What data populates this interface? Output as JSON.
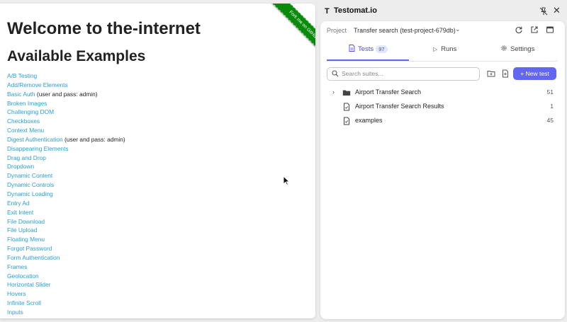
{
  "page": {
    "heading": "Welcome to the-internet",
    "subheading": "Available Examples",
    "ribbon": "Fork me on GitHub",
    "examples": [
      {
        "label": "A/B Testing",
        "note": ""
      },
      {
        "label": "Add/Remove Elements",
        "note": ""
      },
      {
        "label": "Basic Auth",
        "note": " (user and pass: admin)"
      },
      {
        "label": "Broken Images",
        "note": ""
      },
      {
        "label": "Challenging DOM",
        "note": ""
      },
      {
        "label": "Checkboxes",
        "note": ""
      },
      {
        "label": "Context Menu",
        "note": ""
      },
      {
        "label": "Digest Authentication",
        "note": " (user and pass: admin)"
      },
      {
        "label": "Disappearing Elements",
        "note": ""
      },
      {
        "label": "Drag and Drop",
        "note": ""
      },
      {
        "label": "Dropdown",
        "note": ""
      },
      {
        "label": "Dynamic Content",
        "note": ""
      },
      {
        "label": "Dynamic Controls",
        "note": ""
      },
      {
        "label": "Dynamic Loading",
        "note": ""
      },
      {
        "label": "Entry Ad",
        "note": ""
      },
      {
        "label": "Exit Intent",
        "note": ""
      },
      {
        "label": "File Download",
        "note": ""
      },
      {
        "label": "File Upload",
        "note": ""
      },
      {
        "label": "Floating Menu",
        "note": ""
      },
      {
        "label": "Forgot Password",
        "note": ""
      },
      {
        "label": "Form Authentication",
        "note": ""
      },
      {
        "label": "Frames",
        "note": ""
      },
      {
        "label": "Geolocation",
        "note": ""
      },
      {
        "label": "Horizontal Slider",
        "note": ""
      },
      {
        "label": "Hovers",
        "note": ""
      },
      {
        "label": "Infinite Scroll",
        "note": ""
      },
      {
        "label": "Inputs",
        "note": ""
      }
    ]
  },
  "panel": {
    "logo": "T",
    "title": "Testomat.io",
    "close": "✕",
    "project_label": "Project",
    "project_value": "Transfer search (test-project-679db)",
    "project_chevron": "⌄",
    "tabs": {
      "tests": "Tests",
      "tests_count": "97",
      "runs": "Runs",
      "settings": "Settings"
    },
    "search_placeholder": "Search suites...",
    "new_test": "+ New test",
    "tree": [
      {
        "label": "Airport Transfer Search",
        "count": "51",
        "type": "folder",
        "chevron": "›"
      },
      {
        "label": "Airport Transfer Search Results",
        "count": "1",
        "type": "file",
        "chevron": ""
      },
      {
        "label": "examples",
        "count": "45",
        "type": "file",
        "chevron": ""
      }
    ],
    "colors": {
      "accent": "#6366f1",
      "link": "#2a9fd6",
      "ribbon": "#0a8a0a"
    }
  }
}
